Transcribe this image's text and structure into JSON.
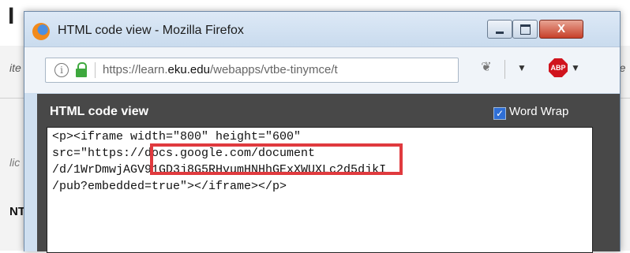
{
  "background": {
    "heading_fragment": "I",
    "italic_fragment_left": "ite",
    "italic_fragment_right": "re",
    "italic_fragment_mid": "lic",
    "bold_fragment": "NT"
  },
  "window": {
    "title": "HTML code view - Mozilla Firefox",
    "close_glyph": "X"
  },
  "navbar": {
    "url_prefix": "https://learn.",
    "url_domain": "eku.edu",
    "url_suffix": "/webapps/vtbe-tinymce/t",
    "info_glyph": "i",
    "dropdown_glyph": "▼",
    "abp_label": "ABP",
    "abp_dropdown_glyph": "▼",
    "bug_glyph": "❦"
  },
  "panel": {
    "title": "HTML code view",
    "word_wrap_label": "Word Wrap",
    "word_wrap_checked": "✓",
    "code_lines": [
      "<p><iframe width=\"800\" height=\"600\"",
      "src=\"https://docs.google.com/document",
      "/d/1WrDmwjAGV91GD3j8G5RHvumHNHhGExXWUXLc2d5djkI",
      "/pub?embedded=true\"></iframe></p>"
    ]
  },
  "colors": {
    "highlight": "#e03a3e",
    "panel_bg": "#484848",
    "close_button": "#c7402a",
    "abp": "#d0141e",
    "lock": "#3ea83e"
  }
}
